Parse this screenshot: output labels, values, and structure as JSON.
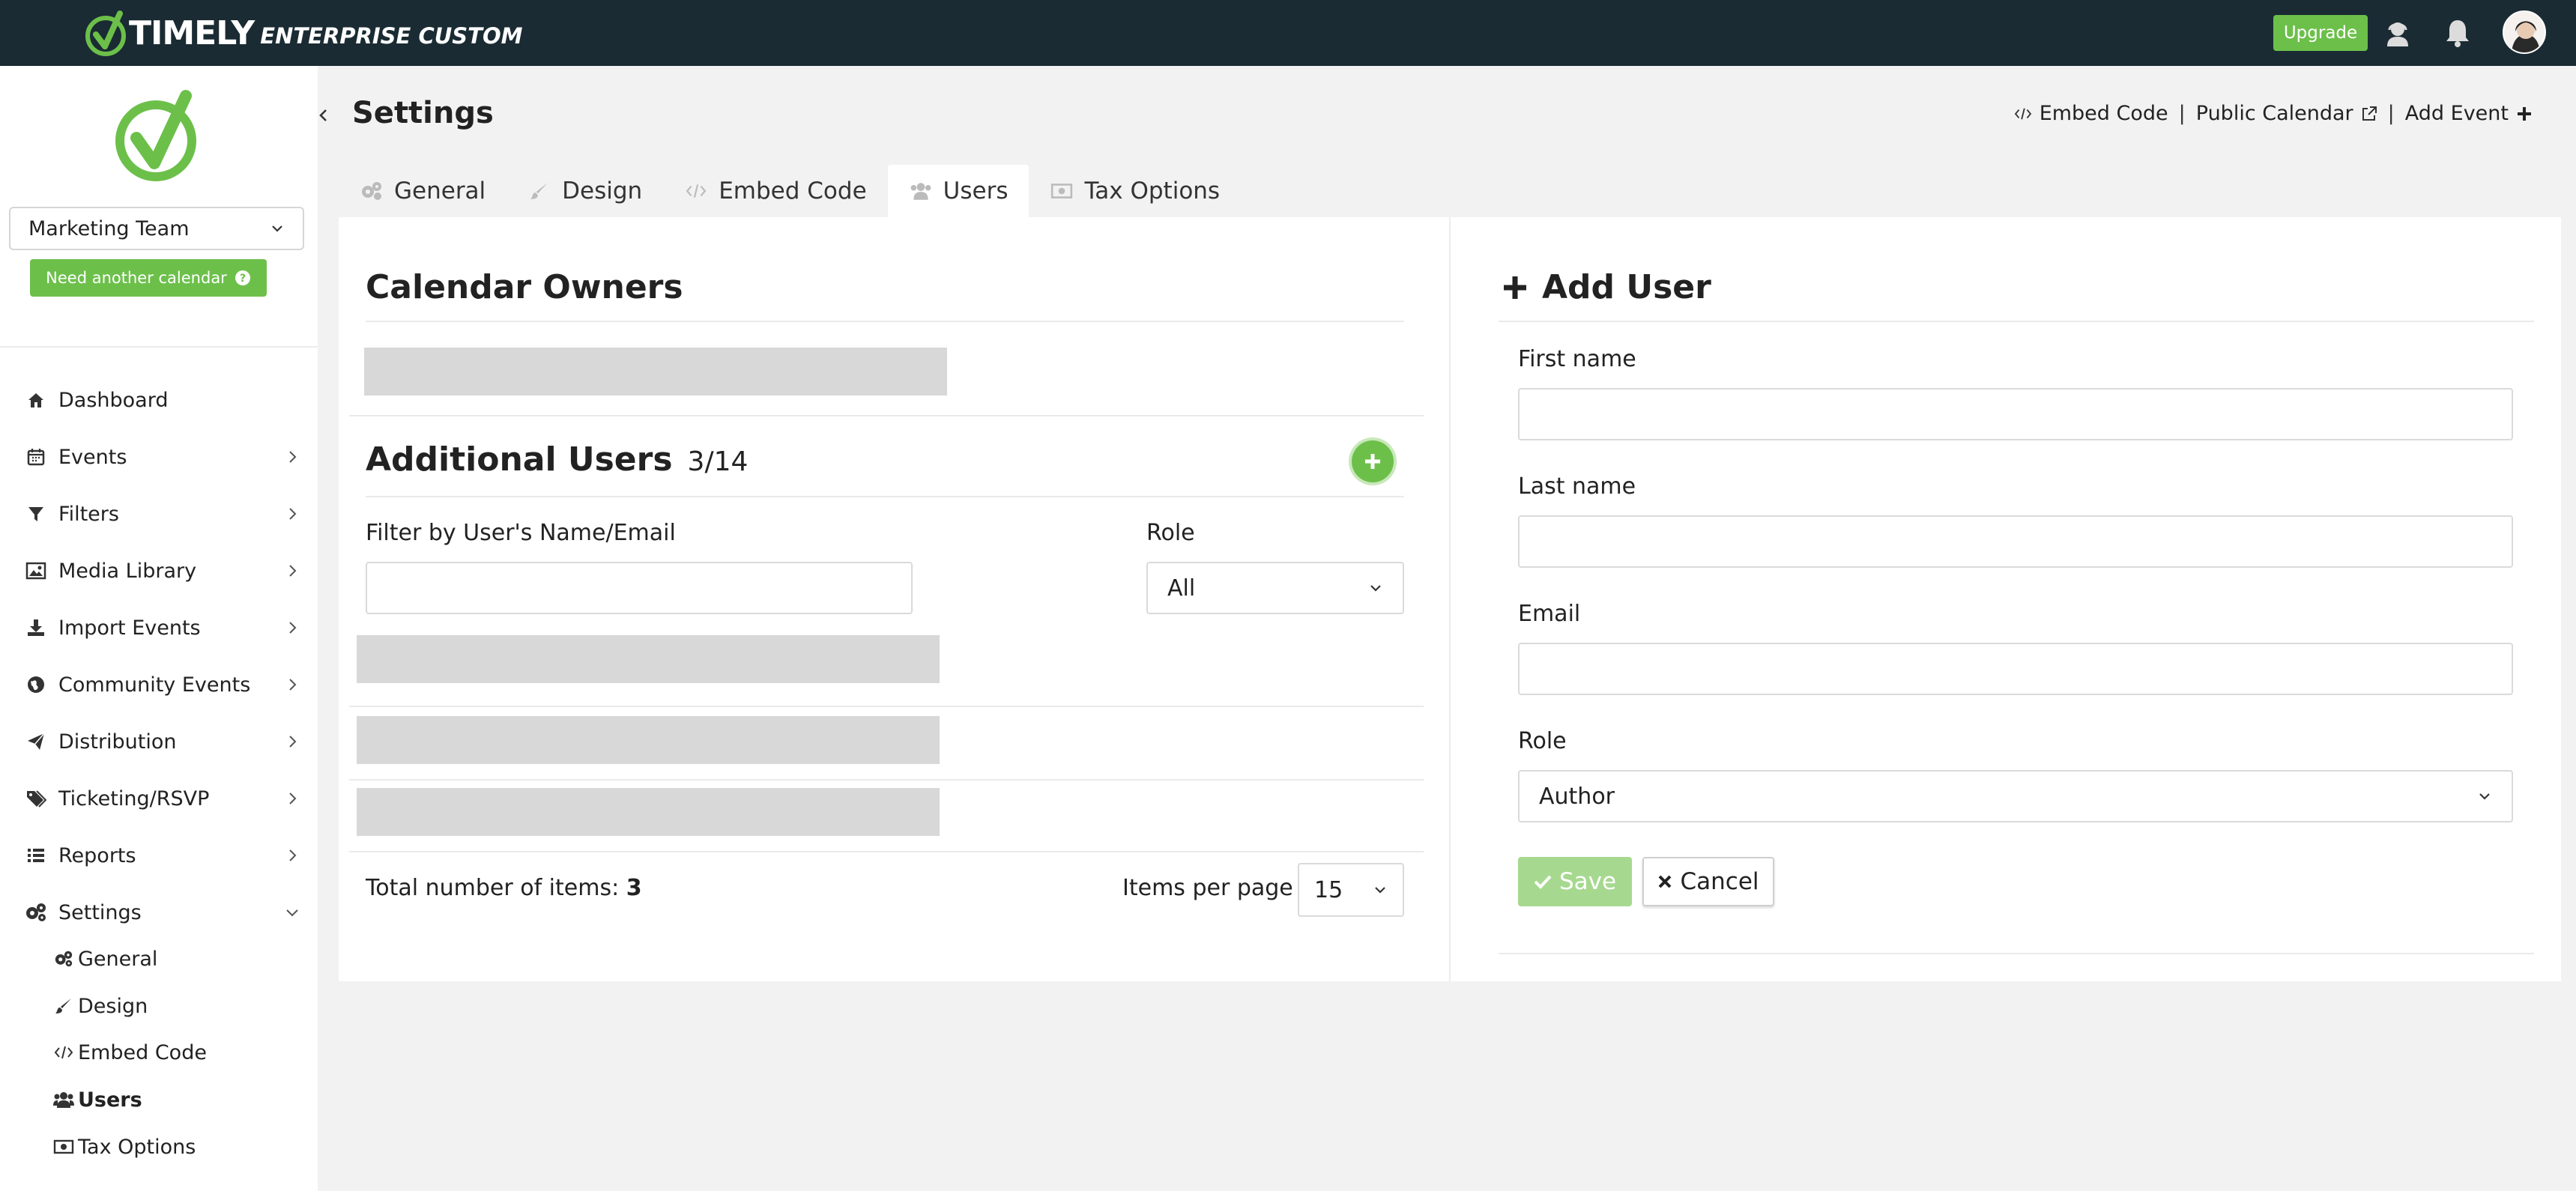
{
  "brand": {
    "name": "TIMELY",
    "edition": "ENTERPRISE CUSTOM",
    "accent_color": "#6cc04a",
    "topbar_color": "#1a2b33"
  },
  "topbar": {
    "upgrade_label": "Upgrade",
    "icons": [
      "support-agent-icon",
      "bell-icon",
      "user-avatar"
    ]
  },
  "sidebar": {
    "calendar_select": "Marketing Team",
    "need_calendar_label": "Need another calendar",
    "items": [
      {
        "label": "Dashboard",
        "icon": "home-icon"
      },
      {
        "label": "Events",
        "icon": "calendar-icon"
      },
      {
        "label": "Filters",
        "icon": "filter-icon"
      },
      {
        "label": "Media Library",
        "icon": "image-icon"
      },
      {
        "label": "Import Events",
        "icon": "download-icon"
      },
      {
        "label": "Community Events",
        "icon": "globe-icon"
      },
      {
        "label": "Distribution",
        "icon": "paper-plane-icon"
      },
      {
        "label": "Ticketing/RSVP",
        "icon": "tags-icon"
      },
      {
        "label": "Reports",
        "icon": "list-icon"
      },
      {
        "label": "Settings",
        "icon": "gears-icon"
      }
    ],
    "settings_sub": [
      {
        "label": "General",
        "icon": "gears-icon"
      },
      {
        "label": "Design",
        "icon": "brush-icon"
      },
      {
        "label": "Embed Code",
        "icon": "code-icon"
      },
      {
        "label": "Users",
        "icon": "users-icon"
      },
      {
        "label": "Tax Options",
        "icon": "money-icon"
      }
    ]
  },
  "header": {
    "title": "Settings",
    "links": {
      "embed_code": "Embed Code",
      "public_calendar": "Public Calendar",
      "add_event": "Add Event"
    }
  },
  "tabs": [
    {
      "label": "General",
      "active": false
    },
    {
      "label": "Design",
      "active": false
    },
    {
      "label": "Embed Code",
      "active": false
    },
    {
      "label": "Users",
      "active": true
    },
    {
      "label": "Tax Options",
      "active": false
    }
  ],
  "owners": {
    "title": "Calendar Owners"
  },
  "additional_users": {
    "title": "Additional Users",
    "count": "3/14",
    "filter_label": "Filter by User's Name/Email",
    "filter_value": "",
    "role_label": "Role",
    "role_value": "All",
    "total_label": "Total number of items:",
    "total_value": "3",
    "ipp_label": "Items per page",
    "ipp_value": "15"
  },
  "add_user": {
    "title": "Add User",
    "first_name_label": "First name",
    "first_name_value": "",
    "last_name_label": "Last name",
    "last_name_value": "",
    "email_label": "Email",
    "email_value": "",
    "role_label": "Role",
    "role_value": "Author",
    "save_label": "Save",
    "cancel_label": "Cancel"
  }
}
